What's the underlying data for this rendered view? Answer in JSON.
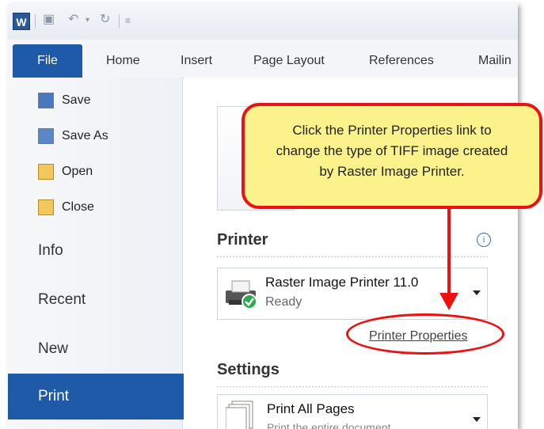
{
  "quick_access": {
    "app_icon": "W"
  },
  "ribbon": {
    "tabs": [
      {
        "label": "File"
      },
      {
        "label": "Home"
      },
      {
        "label": "Insert"
      },
      {
        "label": "Page Layout"
      },
      {
        "label": "References"
      },
      {
        "label": "Mailin"
      }
    ]
  },
  "backstage": {
    "items": [
      {
        "label": "Save",
        "icon": "save-icon"
      },
      {
        "label": "Save As",
        "icon": "save-as-icon"
      },
      {
        "label": "Open",
        "icon": "open-folder-icon"
      },
      {
        "label": "Close",
        "icon": "close-folder-icon"
      },
      {
        "label": "Info"
      },
      {
        "label": "Recent"
      },
      {
        "label": "New"
      },
      {
        "label": "Print"
      }
    ]
  },
  "print_panel": {
    "printer_section_title": "Printer",
    "printer_name": "Raster Image Printer 11.0",
    "printer_status": "Ready",
    "printer_properties_link": "Printer Properties",
    "settings_section_title": "Settings",
    "settings_option": "Print All Pages",
    "settings_option_sub": "Print the entire document"
  },
  "callout": {
    "text_line1": "Click the Printer Properties link to",
    "text_line2": "change the type of TIFF image created",
    "text_line3": "by Raster Image Printer."
  },
  "colors": {
    "accent": "#1f5aa9",
    "callout_fill": "#fbf28b",
    "callout_border": "#ee1111"
  }
}
